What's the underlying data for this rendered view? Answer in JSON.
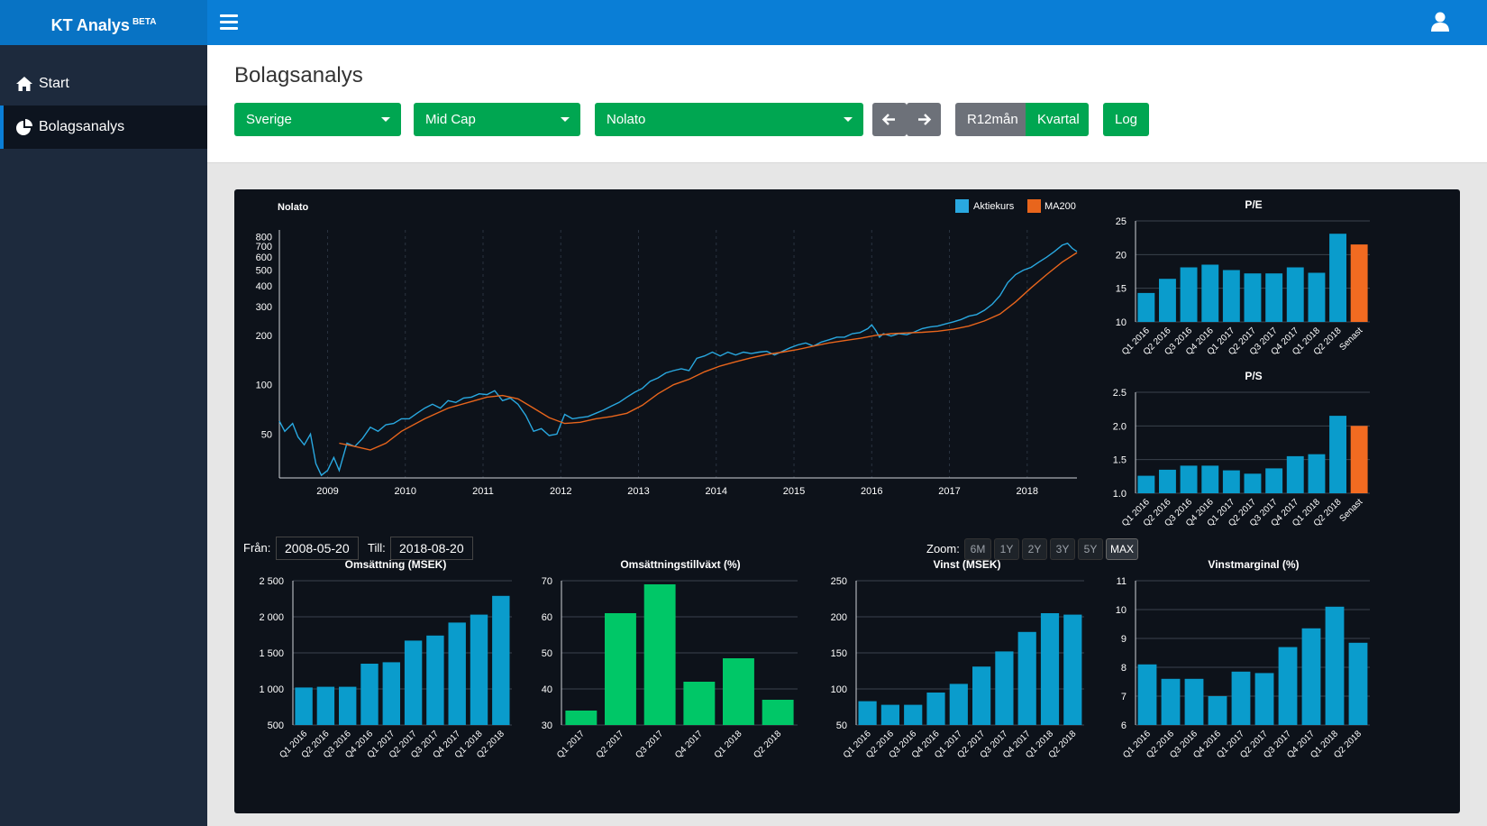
{
  "app": {
    "name": "KT Analys",
    "badge": "BETA"
  },
  "sidebar": {
    "items": [
      {
        "label": "Start",
        "icon": "home-icon"
      },
      {
        "label": "Bolagsanalys",
        "icon": "pie-chart-icon"
      }
    ]
  },
  "page": {
    "title": "Bolagsanalys"
  },
  "filters": {
    "country": "Sverige",
    "segment": "Mid Cap",
    "company": "Nolato",
    "r12": "R12mån",
    "quarter": "Kvartal",
    "log": "Log"
  },
  "range": {
    "from_label": "Från:",
    "from_value": "2008-05-20",
    "to_label": "Till:",
    "to_value": "2018-08-20",
    "zoom_label": "Zoom:",
    "zoom_options": [
      "6M",
      "1Y",
      "2Y",
      "3Y",
      "5Y",
      "MAX"
    ],
    "zoom_selected": "MAX"
  },
  "colors": {
    "accent": "#0a7ed6",
    "green": "#00a651",
    "bar_blue": "#0a9ccc",
    "bar_green": "#00c767",
    "bar_orange": "#f26b21",
    "line_blue": "#29a8e0",
    "line_orange": "#e8651c"
  },
  "chart_data": [
    {
      "id": "price",
      "type": "line",
      "title": "Nolato",
      "legend": [
        "Aktiekurs",
        "MA200"
      ],
      "scale": "log",
      "ylim": [
        27,
        880
      ],
      "xlim": [
        2008.38,
        2018.64
      ],
      "y_ticks": [
        50,
        100,
        200,
        300,
        400,
        500,
        600,
        700,
        800
      ],
      "x_ticks": [
        "2009",
        "2010",
        "2011",
        "2012",
        "2013",
        "2014",
        "2015",
        "2016",
        "2017",
        "2018"
      ],
      "series": [
        {
          "name": "Aktiekurs",
          "points": [
            [
              2008.38,
              60
            ],
            [
              2008.45,
              52
            ],
            [
              2008.55,
              58
            ],
            [
              2008.62,
              48
            ],
            [
              2008.7,
              43
            ],
            [
              2008.78,
              50
            ],
            [
              2008.85,
              33
            ],
            [
              2008.92,
              28
            ],
            [
              2009.0,
              30
            ],
            [
              2009.08,
              36
            ],
            [
              2009.15,
              30
            ],
            [
              2009.25,
              44
            ],
            [
              2009.35,
              42
            ],
            [
              2009.45,
              47
            ],
            [
              2009.55,
              55
            ],
            [
              2009.65,
              52
            ],
            [
              2009.75,
              57
            ],
            [
              2009.85,
              58
            ],
            [
              2009.95,
              62
            ],
            [
              2010.05,
              62
            ],
            [
              2010.15,
              67
            ],
            [
              2010.25,
              72
            ],
            [
              2010.35,
              76
            ],
            [
              2010.45,
              72
            ],
            [
              2010.55,
              80
            ],
            [
              2010.65,
              78
            ],
            [
              2010.75,
              83
            ],
            [
              2010.85,
              84
            ],
            [
              2010.95,
              88
            ],
            [
              2011.05,
              87
            ],
            [
              2011.15,
              92
            ],
            [
              2011.25,
              80
            ],
            [
              2011.35,
              83
            ],
            [
              2011.45,
              76
            ],
            [
              2011.55,
              65
            ],
            [
              2011.65,
              52
            ],
            [
              2011.75,
              54
            ],
            [
              2011.85,
              49
            ],
            [
              2011.95,
              50
            ],
            [
              2012.05,
              66
            ],
            [
              2012.15,
              62
            ],
            [
              2012.25,
              63
            ],
            [
              2012.35,
              64
            ],
            [
              2012.45,
              67
            ],
            [
              2012.55,
              70
            ],
            [
              2012.65,
              74
            ],
            [
              2012.75,
              78
            ],
            [
              2012.85,
              84
            ],
            [
              2012.95,
              90
            ],
            [
              2013.05,
              95
            ],
            [
              2013.15,
              105
            ],
            [
              2013.25,
              110
            ],
            [
              2013.35,
              118
            ],
            [
              2013.45,
              122
            ],
            [
              2013.55,
              125
            ],
            [
              2013.65,
              122
            ],
            [
              2013.75,
              145
            ],
            [
              2013.85,
              150
            ],
            [
              2013.95,
              158
            ],
            [
              2014.05,
              150
            ],
            [
              2014.15,
              158
            ],
            [
              2014.25,
              152
            ],
            [
              2014.35,
              158
            ],
            [
              2014.45,
              155
            ],
            [
              2014.55,
              158
            ],
            [
              2014.65,
              160
            ],
            [
              2014.75,
              152
            ],
            [
              2014.85,
              160
            ],
            [
              2014.95,
              168
            ],
            [
              2015.05,
              175
            ],
            [
              2015.15,
              180
            ],
            [
              2015.25,
              172
            ],
            [
              2015.35,
              182
            ],
            [
              2015.45,
              188
            ],
            [
              2015.55,
              195
            ],
            [
              2015.65,
              195
            ],
            [
              2015.75,
              205
            ],
            [
              2015.85,
              208
            ],
            [
              2015.95,
              220
            ],
            [
              2016.0,
              232
            ],
            [
              2016.05,
              215
            ],
            [
              2016.1,
              195
            ],
            [
              2016.15,
              205
            ],
            [
              2016.25,
              198
            ],
            [
              2016.35,
              205
            ],
            [
              2016.45,
              202
            ],
            [
              2016.55,
              210
            ],
            [
              2016.65,
              220
            ],
            [
              2016.75,
              225
            ],
            [
              2016.85,
              228
            ],
            [
              2016.95,
              235
            ],
            [
              2017.05,
              242
            ],
            [
              2017.15,
              250
            ],
            [
              2017.25,
              262
            ],
            [
              2017.35,
              268
            ],
            [
              2017.45,
              285
            ],
            [
              2017.55,
              310
            ],
            [
              2017.65,
              350
            ],
            [
              2017.75,
              420
            ],
            [
              2017.85,
              470
            ],
            [
              2017.95,
              500
            ],
            [
              2018.05,
              520
            ],
            [
              2018.15,
              560
            ],
            [
              2018.25,
              600
            ],
            [
              2018.35,
              650
            ],
            [
              2018.45,
              710
            ],
            [
              2018.52,
              730
            ],
            [
              2018.58,
              680
            ],
            [
              2018.64,
              650
            ]
          ]
        },
        {
          "name": "MA200",
          "points": [
            [
              2009.15,
              44
            ],
            [
              2009.35,
              42
            ],
            [
              2009.55,
              40
            ],
            [
              2009.75,
              44
            ],
            [
              2009.95,
              52
            ],
            [
              2010.25,
              62
            ],
            [
              2010.55,
              72
            ],
            [
              2010.85,
              79
            ],
            [
              2011.05,
              84
            ],
            [
              2011.25,
              86
            ],
            [
              2011.45,
              82
            ],
            [
              2011.65,
              72
            ],
            [
              2011.85,
              63
            ],
            [
              2012.05,
              58
            ],
            [
              2012.25,
              59
            ],
            [
              2012.45,
              62
            ],
            [
              2012.65,
              64
            ],
            [
              2012.85,
              67
            ],
            [
              2013.05,
              75
            ],
            [
              2013.25,
              88
            ],
            [
              2013.45,
              100
            ],
            [
              2013.65,
              108
            ],
            [
              2013.85,
              120
            ],
            [
              2014.05,
              130
            ],
            [
              2014.25,
              138
            ],
            [
              2014.45,
              146
            ],
            [
              2014.65,
              153
            ],
            [
              2014.85,
              158
            ],
            [
              2015.05,
              164
            ],
            [
              2015.25,
              172
            ],
            [
              2015.45,
              180
            ],
            [
              2015.65,
              186
            ],
            [
              2015.85,
              192
            ],
            [
              2016.05,
              200
            ],
            [
              2016.25,
              205
            ],
            [
              2016.45,
              207
            ],
            [
              2016.65,
              209
            ],
            [
              2016.85,
              212
            ],
            [
              2017.05,
              218
            ],
            [
              2017.25,
              228
            ],
            [
              2017.45,
              245
            ],
            [
              2017.65,
              270
            ],
            [
              2017.85,
              320
            ],
            [
              2018.05,
              390
            ],
            [
              2018.25,
              470
            ],
            [
              2018.45,
              560
            ],
            [
              2018.64,
              640
            ]
          ]
        }
      ]
    },
    {
      "id": "pe",
      "type": "bar",
      "title": "P/E",
      "categories": [
        "Q1 2016",
        "Q2 2016",
        "Q3 2016",
        "Q4 2016",
        "Q1 2017",
        "Q2 2017",
        "Q3 2017",
        "Q4 2017",
        "Q1 2018",
        "Q2 2018",
        "Senast"
      ],
      "values": [
        14.3,
        16.4,
        18.1,
        18.5,
        17.7,
        17.2,
        17.2,
        18.1,
        17.3,
        23.1,
        21.5
      ],
      "ylim": [
        10,
        25
      ],
      "yticks": [
        10,
        15,
        20,
        25
      ],
      "highlight_last": true
    },
    {
      "id": "ps",
      "type": "bar",
      "title": "P/S",
      "categories": [
        "Q1 2016",
        "Q2 2016",
        "Q3 2016",
        "Q4 2016",
        "Q1 2017",
        "Q2 2017",
        "Q3 2017",
        "Q4 2017",
        "Q1 2018",
        "Q2 2018",
        "Senast"
      ],
      "values": [
        1.26,
        1.35,
        1.41,
        1.41,
        1.34,
        1.29,
        1.37,
        1.55,
        1.58,
        2.15,
        2.0
      ],
      "ylim": [
        1.0,
        2.5
      ],
      "yticks": [
        "1.0",
        "1.5",
        "2.0",
        "2.5"
      ],
      "highlight_last": true
    },
    {
      "id": "revenue",
      "type": "bar",
      "title": "Omsättning (MSEK)",
      "categories": [
        "Q1 2016",
        "Q2 2016",
        "Q3 2016",
        "Q4 2016",
        "Q1 2017",
        "Q2 2017",
        "Q3 2017",
        "Q4 2017",
        "Q1 2018",
        "Q2 2018"
      ],
      "values": [
        1020,
        1030,
        1030,
        1350,
        1370,
        1670,
        1740,
        1920,
        2030,
        2290
      ],
      "ylim": [
        500,
        2500
      ],
      "yticks": [
        "500",
        "1 000",
        "1 500",
        "2 000",
        "2 500"
      ]
    },
    {
      "id": "growth",
      "type": "bar",
      "title": "Omsättningstillväxt (%)",
      "categories": [
        "Q1 2017",
        "Q2 2017",
        "Q3 2017",
        "Q4 2017",
        "Q1 2018",
        "Q2 2018"
      ],
      "values": [
        34,
        61,
        69,
        42,
        48.5,
        37
      ],
      "ylim": [
        30,
        70
      ],
      "yticks": [
        30,
        40,
        50,
        60,
        70
      ],
      "green": true
    },
    {
      "id": "profit",
      "type": "bar",
      "title": "Vinst (MSEK)",
      "categories": [
        "Q1 2016",
        "Q2 2016",
        "Q3 2016",
        "Q4 2016",
        "Q1 2017",
        "Q2 2017",
        "Q3 2017",
        "Q4 2017",
        "Q1 2018",
        "Q2 2018"
      ],
      "values": [
        83,
        78,
        78,
        95,
        107,
        131,
        152,
        179,
        205,
        203
      ],
      "ylim": [
        50,
        250
      ],
      "yticks": [
        50,
        100,
        150,
        200,
        250
      ]
    },
    {
      "id": "margin",
      "type": "bar",
      "title": "Vinstmarginal (%)",
      "categories": [
        "Q1 2016",
        "Q2 2016",
        "Q3 2016",
        "Q4 2016",
        "Q1 2017",
        "Q2 2017",
        "Q3 2017",
        "Q4 2017",
        "Q1 2018",
        "Q2 2018"
      ],
      "values": [
        8.1,
        7.6,
        7.6,
        7.0,
        7.85,
        7.8,
        8.7,
        9.35,
        10.1,
        8.85
      ],
      "ylim": [
        6,
        11
      ],
      "yticks": [
        6,
        7,
        8,
        9,
        10,
        11
      ]
    }
  ]
}
